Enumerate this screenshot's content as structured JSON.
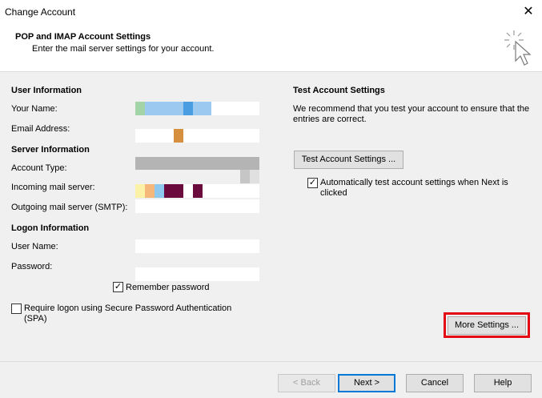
{
  "window": {
    "title": "Change Account",
    "close_glyph": "✕"
  },
  "header": {
    "title": "POP and IMAP Account Settings",
    "subtitle": "Enter the mail server settings for your account."
  },
  "user_info": {
    "section_title": "User Information",
    "your_name_label": "Your Name:",
    "email_label": "Email Address:"
  },
  "server_info": {
    "section_title": "Server Information",
    "account_type_label": "Account Type:",
    "incoming_label": "Incoming mail server:",
    "outgoing_label": "Outgoing mail server (SMTP):"
  },
  "logon_info": {
    "section_title": "Logon Information",
    "username_label": "User Name:",
    "password_label": "Password:",
    "remember_password_label": "Remember password",
    "remember_password_checked": true,
    "spa_label": "Require logon using Secure Password Authentication (SPA)",
    "spa_checked": false
  },
  "test_settings": {
    "section_title": "Test Account Settings",
    "description": "We recommend that you test your account to ensure that the entries are correct.",
    "test_button": "Test Account Settings ...",
    "auto_test_label": "Automatically test account settings when Next is clicked",
    "auto_test_checked": true
  },
  "buttons": {
    "more_settings": "More Settings ...",
    "back": "< Back",
    "next": "Next >",
    "cancel": "Cancel",
    "help": "Help"
  },
  "colors": {
    "highlight_border": "#e30613",
    "default_button_border": "#0078d7"
  }
}
